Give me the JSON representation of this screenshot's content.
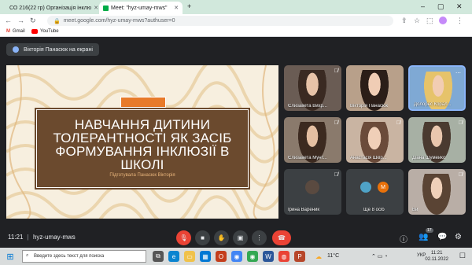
{
  "browser": {
    "tabs": [
      {
        "title": "СО 216(22 гр) Організація інклю"
      },
      {
        "title": "Meet: \"hyz-umay-mws\""
      }
    ],
    "new_tab": "+",
    "address": "meet.google.com/hyz-umay-mws?authuser=0",
    "bookmarks": [
      "Gmail",
      "YouTube"
    ]
  },
  "meet": {
    "presenting_label": "Вікторія Панасюк на екрані",
    "slide": {
      "title_lines": [
        "НАВЧАННЯ ДИТИНИ",
        "ТОЛЕРАНТНОСТІ ЯК ЗАСІБ",
        "ФОРМУВАННЯ ІНКЛЮЗІЇ В",
        "ШКОЛІ"
      ],
      "subtitle": "Підготувала Панасюк Вікторія"
    },
    "participants": [
      {
        "name": "Єлизавета Вихр...",
        "muted": true
      },
      {
        "name": "Вікторія Панасюк",
        "muted": false
      },
      {
        "name": "Долорес Корал...",
        "muted": false
      },
      {
        "name": "Єлизавета Мунт...",
        "muted": true
      },
      {
        "name": "Анастасія Шкір...",
        "muted": true
      },
      {
        "name": "Діана Шумейко",
        "muted": true
      },
      {
        "name": "Ірина Вареник",
        "muted": true
      },
      {
        "name": "Ще 8 осіб",
        "muted": false
      },
      {
        "name": "Ви",
        "muted": true
      }
    ],
    "others_avatar_letter": "М",
    "bottom": {
      "time": "11:21",
      "meeting_code": "hyz-umay-mws",
      "people_count": "17"
    }
  },
  "taskbar": {
    "search_placeholder": "Введите здесь текст для поиска",
    "weather": "11°C",
    "lang": "УКР",
    "clock_time": "11:21",
    "clock_date": "02.11.2022"
  },
  "colors": {
    "meet_bg": "#202124",
    "slide_brown": "#6b4a2e",
    "slide_orange": "#e87a2a",
    "end_call_red": "#ea4335"
  }
}
